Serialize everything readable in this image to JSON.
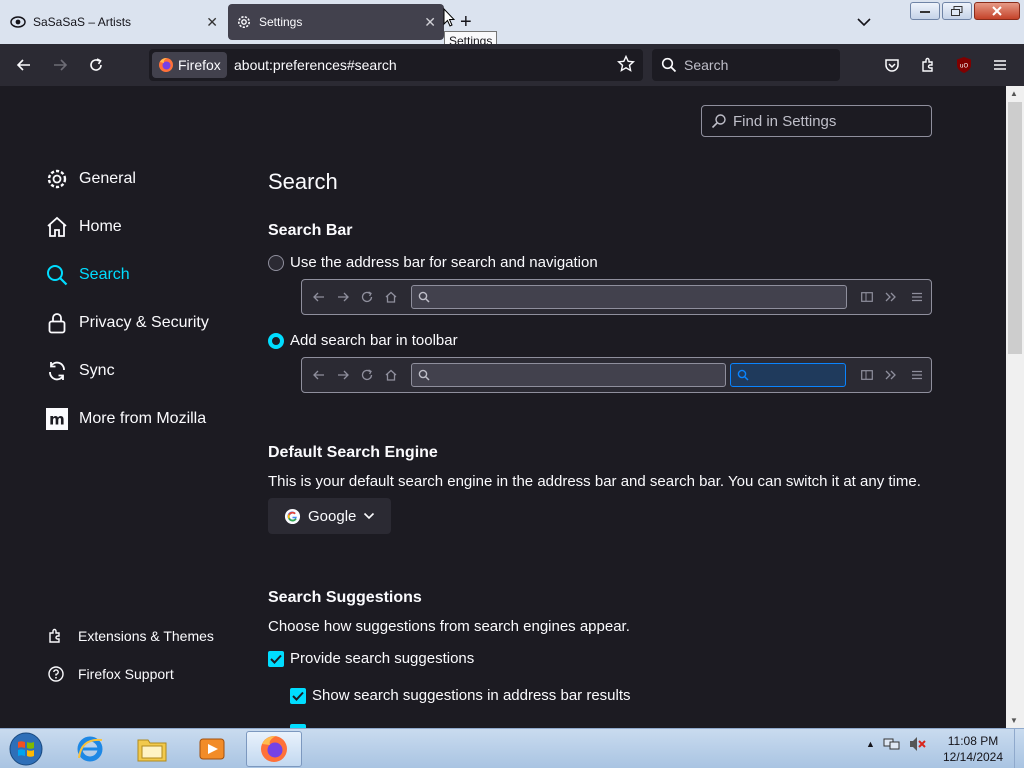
{
  "browser": {
    "tabs": [
      {
        "title": "SaSaSaS – Artists",
        "active": false
      },
      {
        "title": "Settings",
        "active": true
      }
    ],
    "tooltip": "Settings",
    "identity_label": "Firefox",
    "url": "about:preferences#search",
    "search_placeholder": "Search"
  },
  "prefs": {
    "find_placeholder": "Find in Settings",
    "categories": [
      {
        "label": "General",
        "icon": "gear-icon"
      },
      {
        "label": "Home",
        "icon": "home-icon"
      },
      {
        "label": "Search",
        "icon": "search-icon",
        "selected": true
      },
      {
        "label": "Privacy & Security",
        "icon": "lock-icon"
      },
      {
        "label": "Sync",
        "icon": "sync-icon"
      },
      {
        "label": "More from Mozilla",
        "icon": "mozilla-icon"
      }
    ],
    "footer_links": [
      {
        "label": "Extensions & Themes",
        "icon": "puzzle-icon"
      },
      {
        "label": "Firefox Support",
        "icon": "help-icon"
      }
    ],
    "page_title": "Search",
    "search_bar": {
      "heading": "Search Bar",
      "option_address": "Use the address bar for search and navigation",
      "option_toolbar": "Add search bar in toolbar",
      "selected": "toolbar"
    },
    "default_engine": {
      "heading": "Default Search Engine",
      "description": "This is your default search engine in the address bar and search bar. You can switch it at any time.",
      "selected": "Google"
    },
    "suggestions": {
      "heading": "Search Suggestions",
      "description": "Choose how suggestions from search engines appear.",
      "provide": "Provide search suggestions",
      "address_bar": "Show search suggestions in address bar results",
      "provide_checked": true,
      "address_bar_checked": true
    }
  },
  "taskbar": {
    "time": "11:08 PM",
    "date": "12/14/2024"
  },
  "colors": {
    "accent": "#00ddff",
    "background": "#1c1b22",
    "toolbar": "#2b2a33"
  }
}
